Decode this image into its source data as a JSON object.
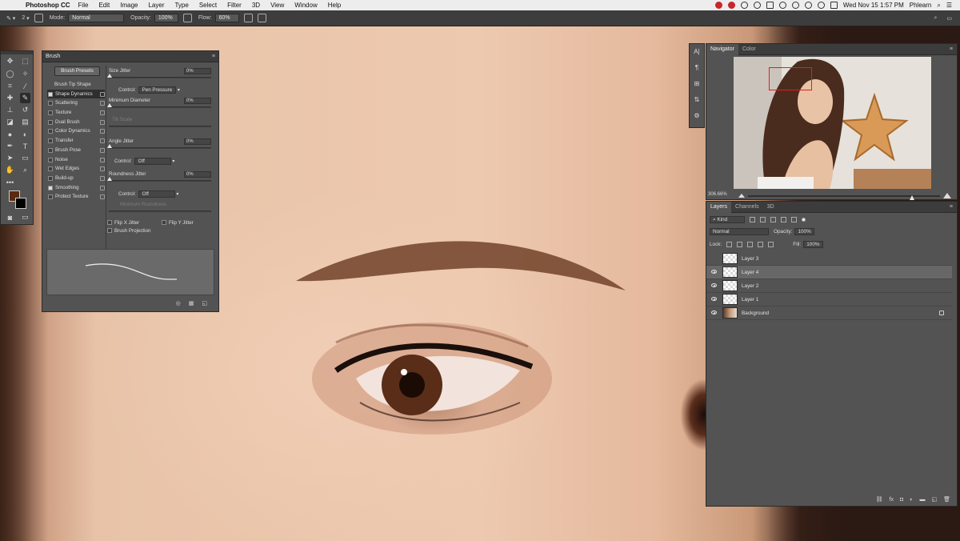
{
  "menubar": {
    "app_name": "Photoshop CC",
    "items": [
      "File",
      "Edit",
      "Image",
      "Layer",
      "Type",
      "Select",
      "Filter",
      "3D",
      "View",
      "Window",
      "Help"
    ],
    "clock": "Wed Nov 15  1:57 PM",
    "user": "Phlearn"
  },
  "options": {
    "brush_size": "2",
    "mode_label": "Mode:",
    "mode_value": "Normal",
    "opacity_label": "Opacity:",
    "opacity_value": "100%",
    "flow_label": "Flow:",
    "flow_value": "60%"
  },
  "brush_panel": {
    "title": "Brush",
    "presets_button": "Brush Presets",
    "items": [
      {
        "label": "Brush Tip Shape"
      },
      {
        "label": "Shape Dynamics",
        "checked": true
      },
      {
        "label": "Scattering",
        "checked": false
      },
      {
        "label": "Texture",
        "checked": false
      },
      {
        "label": "Dual Brush",
        "checked": false
      },
      {
        "label": "Color Dynamics",
        "checked": false
      },
      {
        "label": "Transfer",
        "checked": false
      },
      {
        "label": "Brush Pose",
        "checked": false
      },
      {
        "label": "Noise",
        "checked": false
      },
      {
        "label": "Wet Edges",
        "checked": false
      },
      {
        "label": "Build-up",
        "checked": false
      },
      {
        "label": "Smoothing",
        "checked": true
      },
      {
        "label": "Protect Texture",
        "checked": false
      }
    ],
    "size_jitter_label": "Size Jitter",
    "size_jitter_value": "0%",
    "control_label": "Control:",
    "control_size_value": "Pen Pressure",
    "min_diameter_label": "Minimum Diameter",
    "min_diameter_value": "0%",
    "tilt_scale_label": "Tilt Scale",
    "angle_jitter_label": "Angle Jitter",
    "angle_jitter_value": "0%",
    "control_angle_value": "Off",
    "roundness_jitter_label": "Roundness Jitter",
    "roundness_jitter_value": "0%",
    "control_round_value": "Off",
    "min_roundness_label": "Minimum Roundness",
    "flip_x_label": "Flip X Jitter",
    "flip_y_label": "Flip Y Jitter",
    "projection_label": "Brush Projection"
  },
  "navigator": {
    "tabs": [
      "Navigator",
      "Color"
    ],
    "zoom": "306.66%"
  },
  "layers": {
    "tabs": [
      "Layers",
      "Channels",
      "3D"
    ],
    "filter_kind": "Kind",
    "blend_mode": "Normal",
    "opacity_label": "Opacity:",
    "opacity_value": "100%",
    "lock_label": "Lock:",
    "fill_label": "Fill:",
    "fill_value": "100%",
    "list": [
      {
        "name": "Layer 3",
        "visible": false,
        "selected": false
      },
      {
        "name": "Layer 4",
        "visible": true,
        "selected": true
      },
      {
        "name": "Layer 2",
        "visible": true,
        "selected": false
      },
      {
        "name": "Layer 1",
        "visible": true,
        "selected": false
      },
      {
        "name": "Background",
        "visible": true,
        "selected": false,
        "locked": true
      }
    ]
  },
  "colors": {
    "foreground": "#5a2a10",
    "background": "#000000",
    "panel_bg": "#535353",
    "selection_red": "#e01e1e"
  }
}
